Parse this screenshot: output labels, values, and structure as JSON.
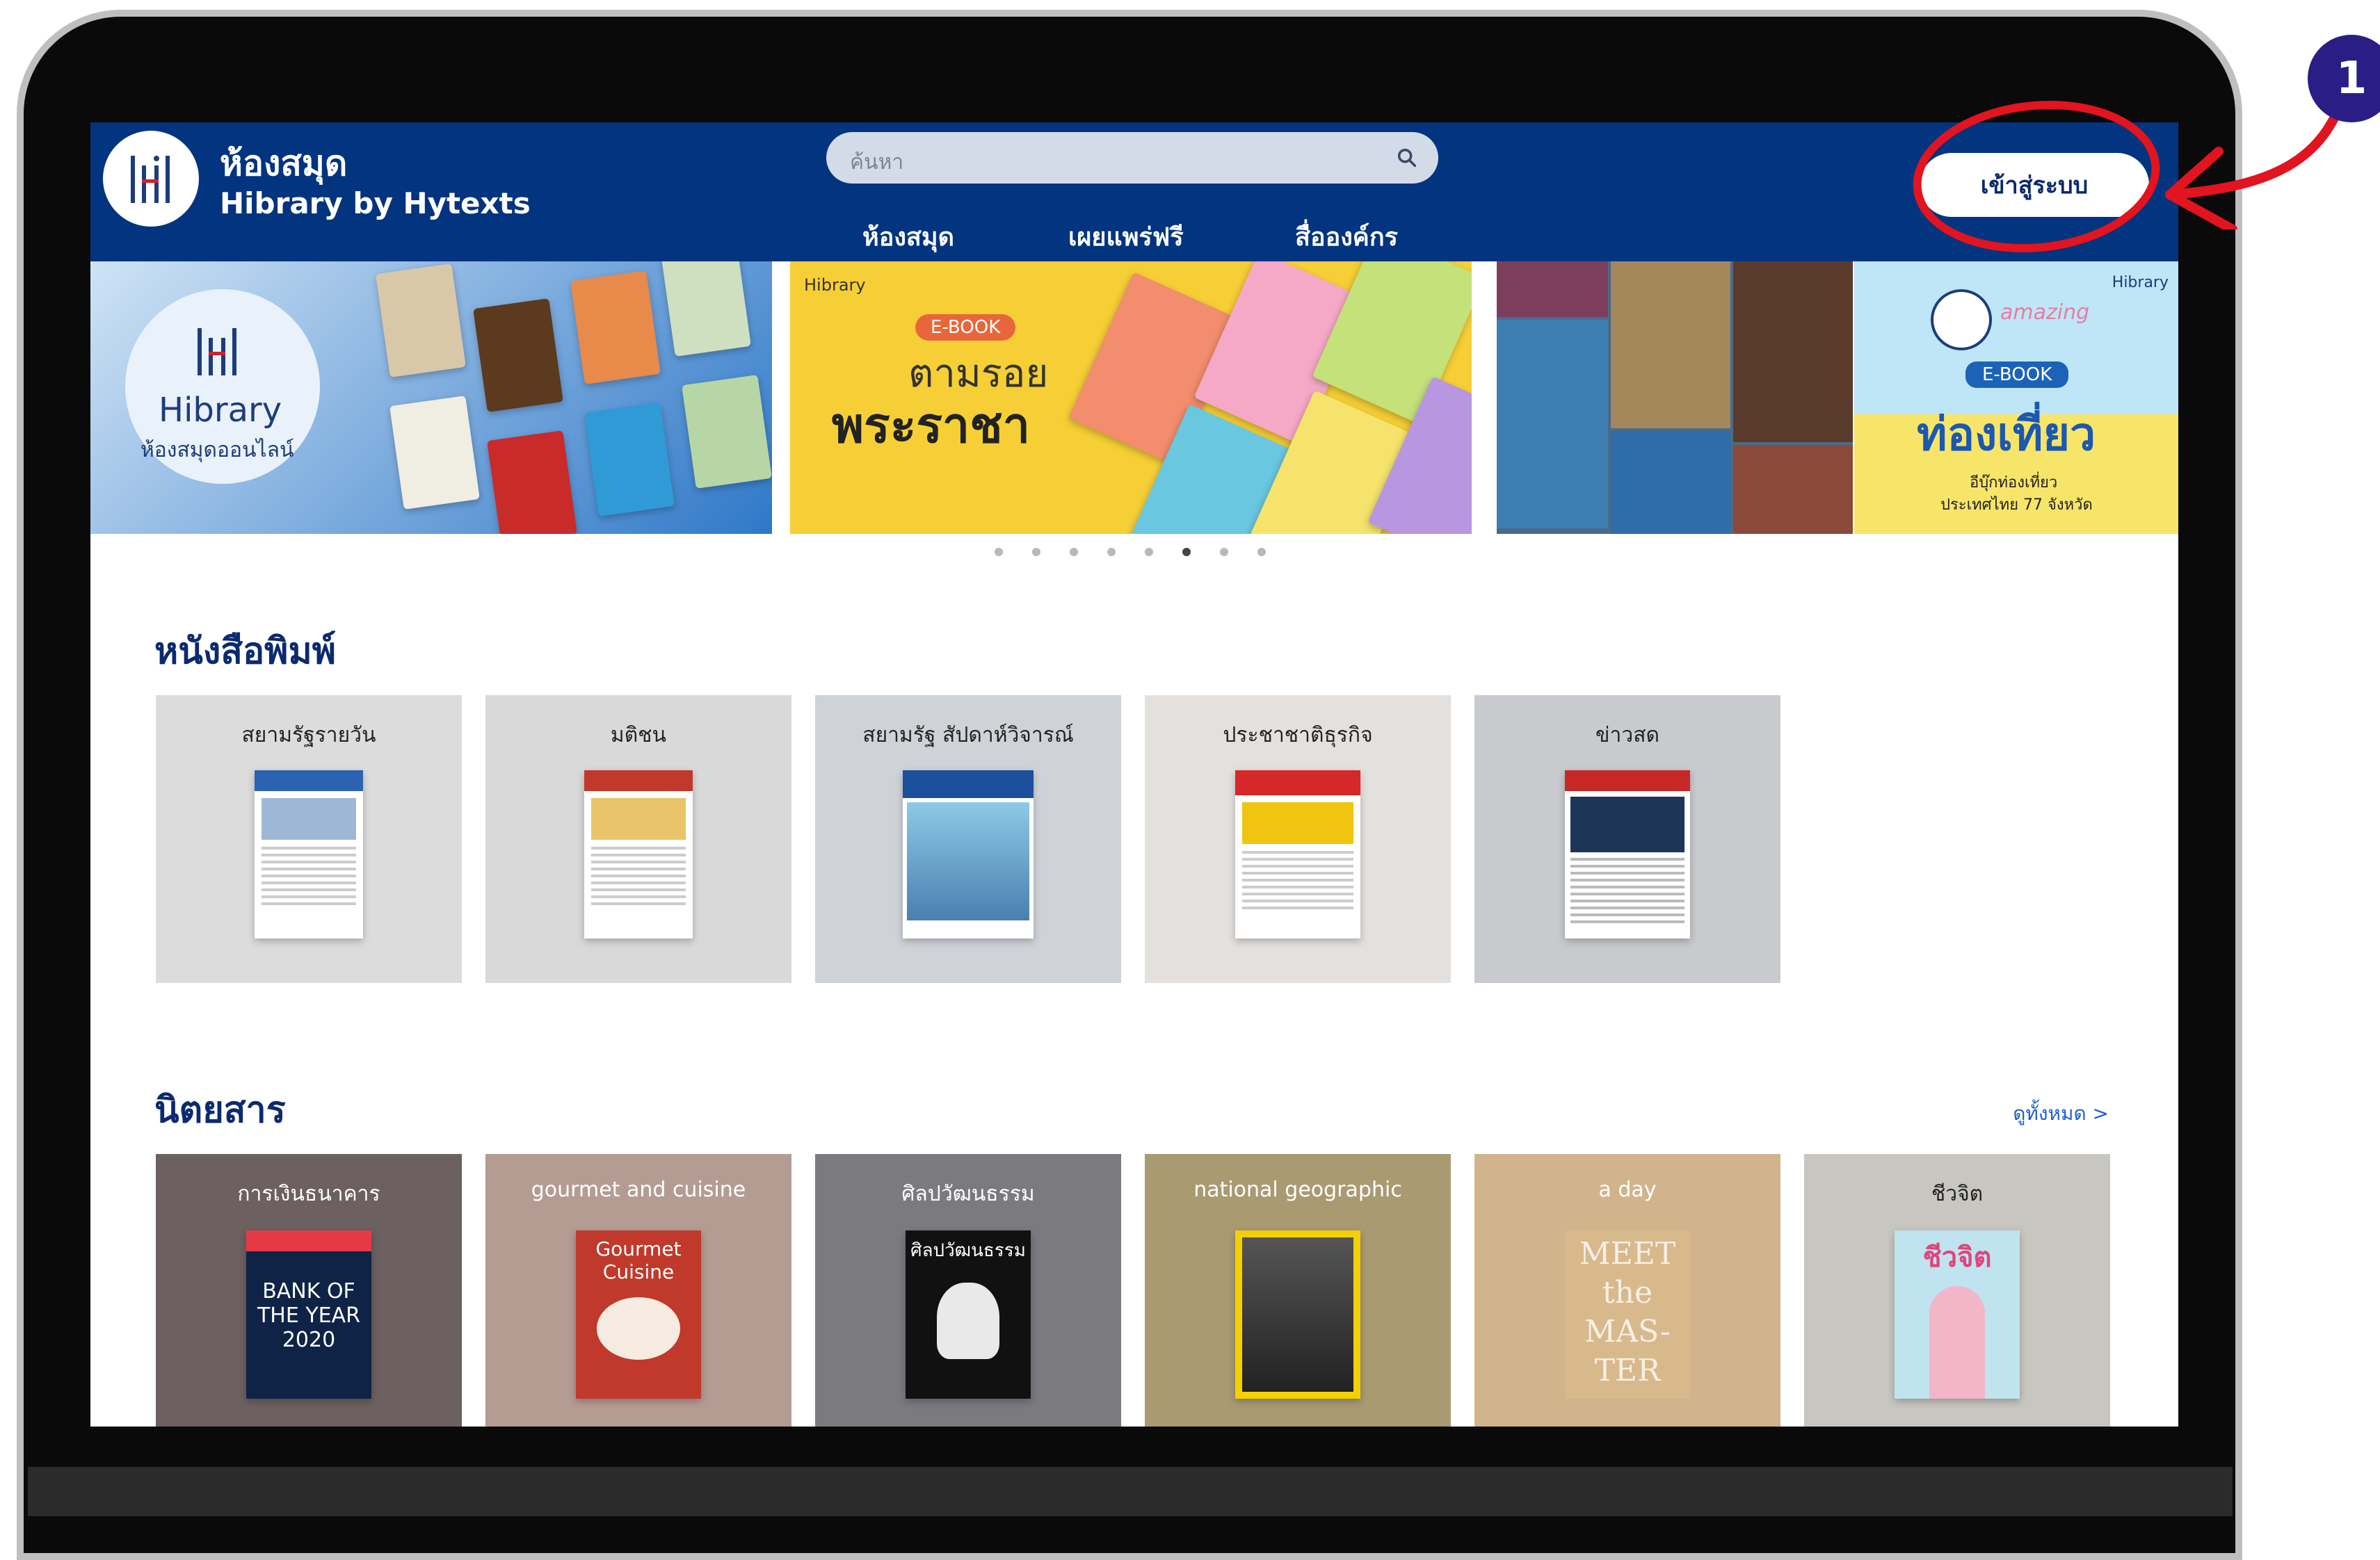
{
  "header": {
    "brand_name": "ห้องสมุด",
    "brand_sub": "Hibrary by Hytexts",
    "search_placeholder": "ค้นหา",
    "nav": [
      "ห้องสมุด",
      "เผยแพร่ฟรี",
      "สื่อองค์กร"
    ],
    "login_label": "เข้าสู่ระบบ"
  },
  "banner": {
    "slide1": {
      "title": "Hibrary",
      "subtitle": "ห้องสมุดออนไลน์"
    },
    "slide2": {
      "brand": "Hibrary",
      "badge": "E-BOOK",
      "line1": "ตามรอย",
      "line2": "พระราชา"
    },
    "slide4": {
      "brand": "Hibrary",
      "amazing": "amazing",
      "badge": "E-BOOK",
      "headline": "ท่องเที่ยว",
      "sub1": "อีบุ๊กท่องเที่ยว",
      "sub2": "ประเทศไทย 77 จังหวัด"
    },
    "dots": 8,
    "active_dot": 5
  },
  "newspapers": {
    "title": "หนังสือพิมพ์",
    "items": [
      {
        "name": "สยามรัฐรายวัน",
        "bg": "#dcdcdc"
      },
      {
        "name": "มติชน",
        "bg": "#d9d9d9"
      },
      {
        "name": "สยามรัฐ สัปดาห์วิจารณ์",
        "bg": "#cfd3d7"
      },
      {
        "name": "ประชาชาติธุรกิจ",
        "bg": "#e4e0dd"
      },
      {
        "name": "ข่าวสด",
        "bg": "#c8cacd"
      }
    ]
  },
  "magazines": {
    "title": "นิตยสาร",
    "see_all": "ดูทั้งหมด >",
    "items": [
      {
        "name": "การเงินธนาคาร",
        "bg": "#6c6060",
        "cover_text": "BANK OF THE YEAR 2020"
      },
      {
        "name": "gourmet and cuisine",
        "bg": "#b49c93",
        "cover_text": "Gourmet Cuisine"
      },
      {
        "name": "ศิลปวัฒนธรรม",
        "bg": "#7b7b7f",
        "cover_text": "ศิลปวัฒนธรรม"
      },
      {
        "name": "national geographic",
        "bg": "#a99a72",
        "cover_text": ""
      },
      {
        "name": "a day",
        "bg": "#d2b48c",
        "cover_text": "MEET the MAS-TER"
      },
      {
        "name": "ชีวจิต",
        "bg": "#c8c6c0",
        "cover_text": "ชีวจิต"
      }
    ]
  },
  "annotation": {
    "number": "1",
    "color": "#e1141f"
  }
}
